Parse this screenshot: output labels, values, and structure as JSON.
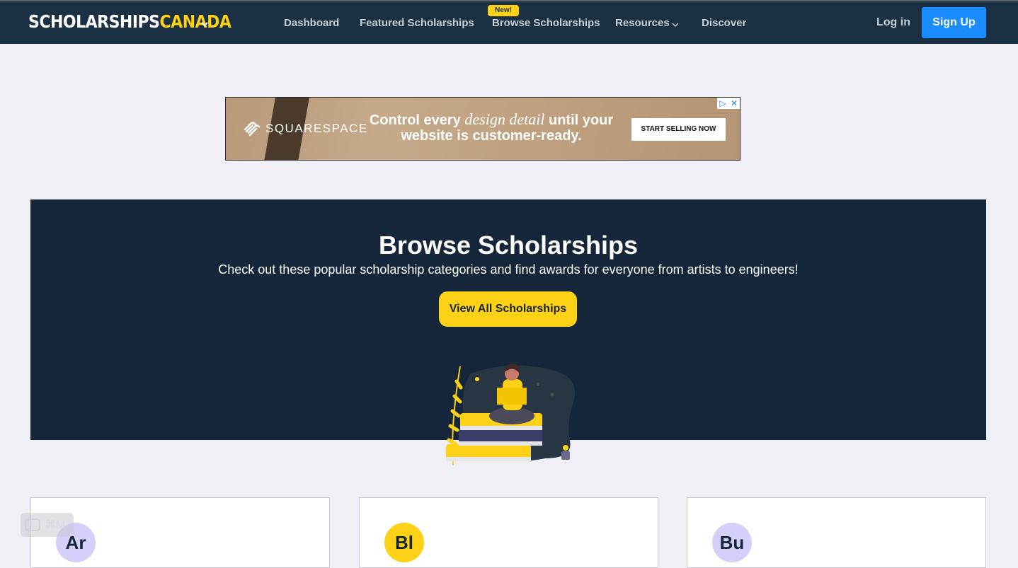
{
  "nav": {
    "logo_part1": "SCHOLARSHIPS",
    "logo_part2": "CANADA",
    "links": [
      {
        "label": "Dashboard"
      },
      {
        "label": "Featured Scholarships"
      },
      {
        "label": "Browse Scholarships",
        "badge": "New!"
      },
      {
        "label": "Resources"
      },
      {
        "label": "Discover"
      }
    ],
    "login": "Log in",
    "signup": "Sign Up"
  },
  "ad": {
    "brand": "SQUARESPACE",
    "text_before": "Control every",
    "text_italic": "design detail",
    "text_after": "until your website is customer-ready.",
    "cta": "START SELLING NOW"
  },
  "hero": {
    "title": "Browse Scholarships",
    "subtitle": "Check out these popular scholarship categories and find awards for everyone from artists to engineers!",
    "button": "View All Scholarships"
  },
  "cards": [
    {
      "abbr": "Ar",
      "color": "#d5d0fa"
    },
    {
      "abbr": "Bl",
      "color": "#fcd116"
    },
    {
      "abbr": "Bu",
      "color": "#d5d0fa"
    }
  ],
  "shortcut": "⌘M",
  "colors": {
    "navy": "#1c3044",
    "hero": "#15263a",
    "accent_yellow": "#fcd116",
    "signup_blue": "#1a8cff"
  }
}
